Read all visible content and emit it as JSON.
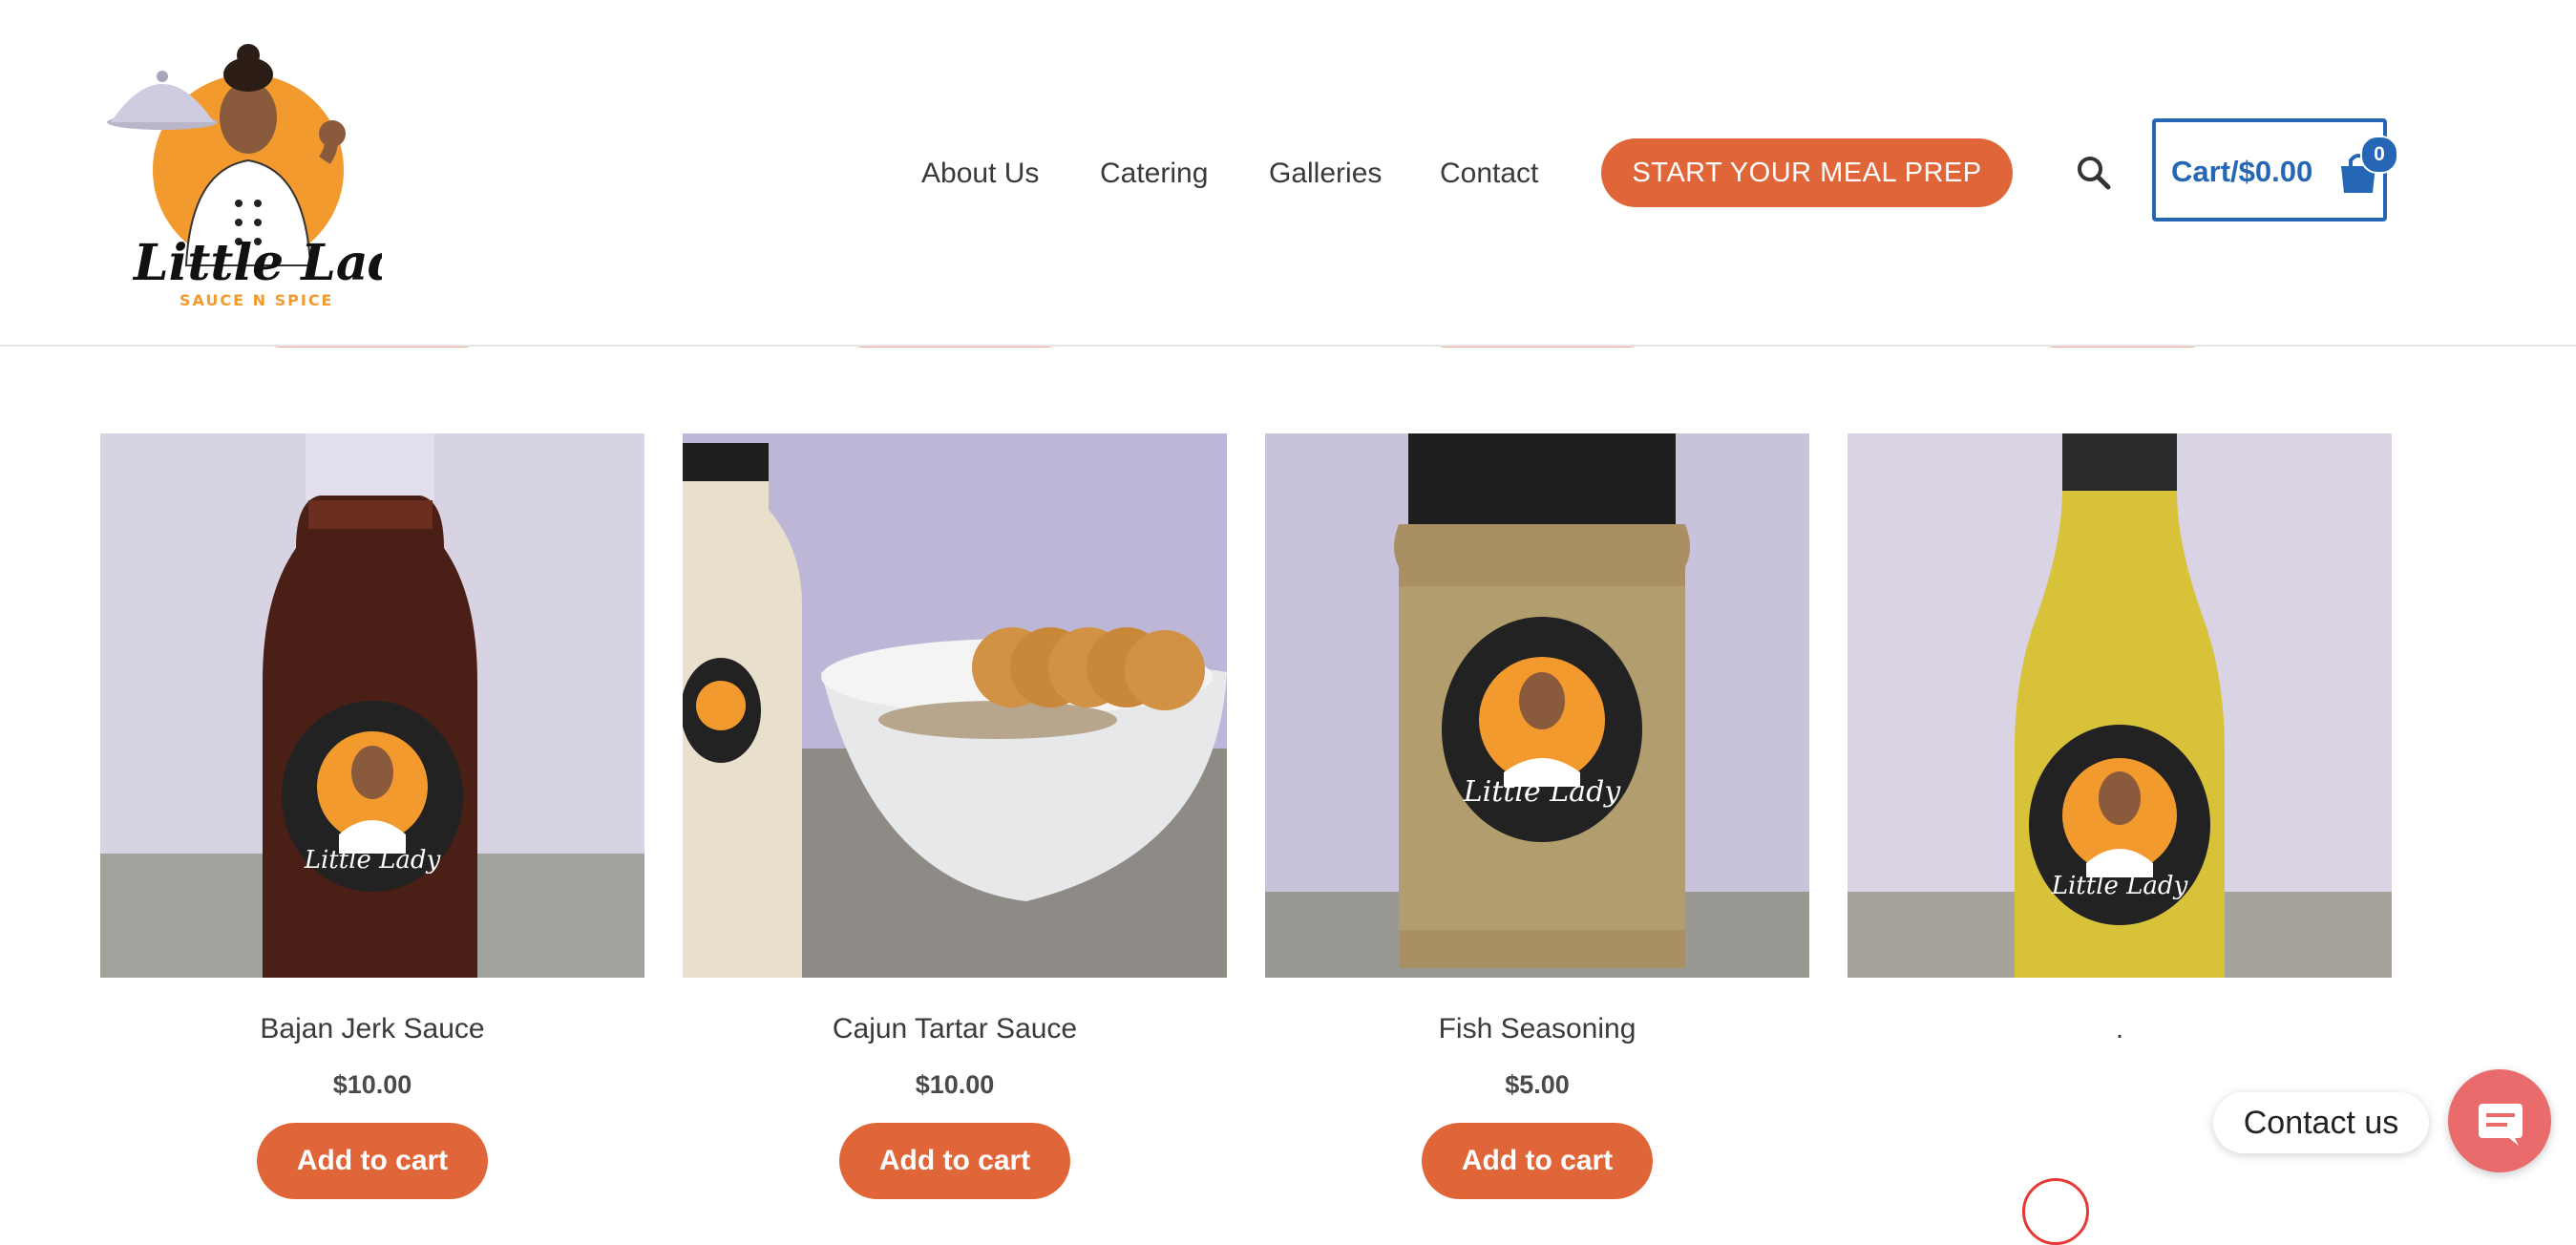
{
  "brand": {
    "logo_script": "Little Lady",
    "logo_tagline": "SAUCE N SPICE"
  },
  "nav": {
    "items": [
      "About Us",
      "Catering",
      "Galleries",
      "Contact"
    ],
    "cta_label": "START YOUR MEAL PREP"
  },
  "cart": {
    "label": "Cart/$0.00",
    "count": "0"
  },
  "products": [
    {
      "name": "Bajan Jerk Sauce",
      "price": "$10.00",
      "button": "Add to cart"
    },
    {
      "name": "Cajun Tartar Sauce",
      "price": "$10.00",
      "button": "Add to cart"
    },
    {
      "name": "Fish Seasoning",
      "price": "$5.00",
      "button": "Add to cart"
    },
    {
      "name": ".",
      "price": "",
      "button": ""
    }
  ],
  "contact": {
    "label": "Contact us"
  },
  "colors": {
    "accent": "#e0663a",
    "cart_blue": "#2567b4",
    "contact_red": "#e96b6b"
  }
}
